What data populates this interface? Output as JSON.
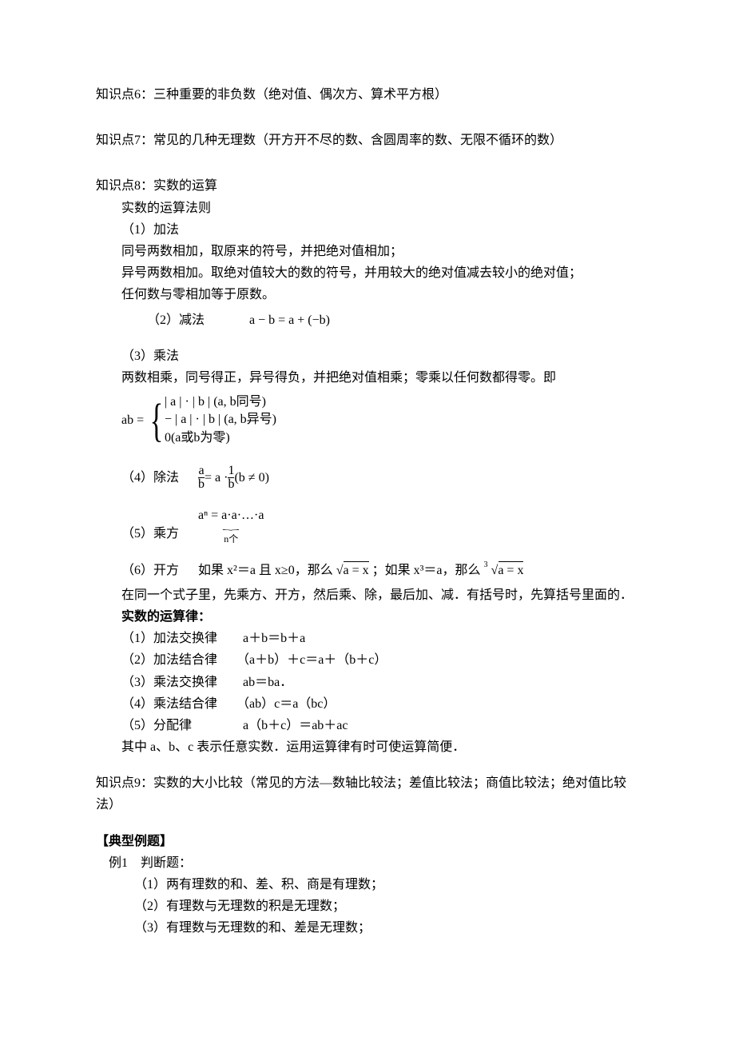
{
  "point6": "知识点6：三种重要的非负数（绝对值、偶次方、算术平方根）",
  "point7": "知识点7：常见的几种无理数（开方开不尽的数、含圆周率的数、无限不循环的数）",
  "point8": {
    "title": "知识点8：实数的运算",
    "sub1": "实数的运算法则",
    "add_h": "（1）加法",
    "add_l1": "同号两数相加，取原来的符号，并把绝对值相加；",
    "add_l2": "异号两数相加。取绝对值较大的数的符号，并用较大的绝对值减去较小的绝对值；",
    "add_l3": "任何数与零相加等于原数。",
    "sub_h": "（2）减法",
    "sub_formula": "a − b = a + (−b)",
    "mul_h": "（3）乘法",
    "mul_l1": "两数相乘，同号得正，异号得负，并把绝对值相乘；零乘以任何数都得零。即",
    "mul_brace_l1": "| a | · | b | (a, b同号)",
    "mul_brace_l2": "− | a | · | b | (a, b异号)",
    "mul_brace_l3": "0(a或b为零)",
    "div_h": "（4）除法",
    "div_formula_parts": {
      "a": "a",
      "b": "b",
      "eq": " = a · ",
      "one": "1",
      "b2": "b",
      "cond": "(b ≠ 0)"
    },
    "pow_h": "（5）乘方",
    "pow_top": "aⁿ = a·a·…·a",
    "pow_underbrace": "n个",
    "root_h": "（6）开方",
    "root_body_p1": "如果 x²＝a 且 x≥0，那么",
    "root_expr1": "√a = x",
    "root_body_p2": "；如果 x³＝a，那么",
    "root_expr2_pre": "3",
    "root_expr2": "√a = x",
    "order": "在同一个式子里，先乘方、开方，然后乘、除，最后加、减．有括号时，先算括号里面的．"
  },
  "laws": {
    "title": "实数的运算律：",
    "l1": "（1）加法交换律　　a＋b＝b＋a",
    "l2": "（2）加法结合律　　（a＋b）＋c＝a＋（b＋c）",
    "l3": "（3）乘法交换律　　ab＝ba．",
    "l4": "（4）乘法结合律　　（ab）c＝a（bc）",
    "l5": "（5）分配律　　　　a（b＋c）＝ab＋ac",
    "note": "其中 a、b、c 表示任意实数．运用运算律有时可使运算简便．"
  },
  "point9": "知识点9：实数的大小比较（常见的方法—数轴比较法；差值比较法；商值比较法；绝对值比较法）",
  "examples": {
    "title": "【典型例题】",
    "e1_h": "例1　判断题：",
    "e1_l1": "（1）两有理数的和、差、积、商是有理数；",
    "e1_l2": "（2）有理数与无理数的积是无理数；",
    "e1_l3": "（3）有理数与无理数的和、差是无理数；"
  }
}
